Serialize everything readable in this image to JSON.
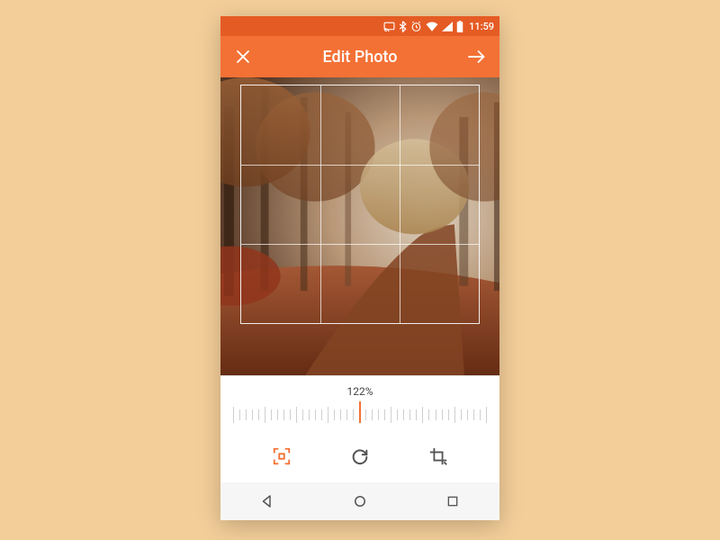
{
  "statusbar": {
    "time": "11:59",
    "icons": [
      "cast",
      "bluetooth",
      "alarm",
      "wifi",
      "signal",
      "battery"
    ]
  },
  "appbar": {
    "title": "Edit Photo",
    "left_icon": "close",
    "right_icon": "forward"
  },
  "editor": {
    "zoom_label": "122%",
    "tools": [
      {
        "id": "frame",
        "active": true
      },
      {
        "id": "rotate",
        "active": false
      },
      {
        "id": "crop",
        "active": false
      }
    ]
  },
  "navbar": {
    "buttons": [
      "back",
      "home",
      "recents"
    ]
  },
  "colors": {
    "accent": "#f37135",
    "status": "#e55b24",
    "bg": "#f3ce99"
  }
}
